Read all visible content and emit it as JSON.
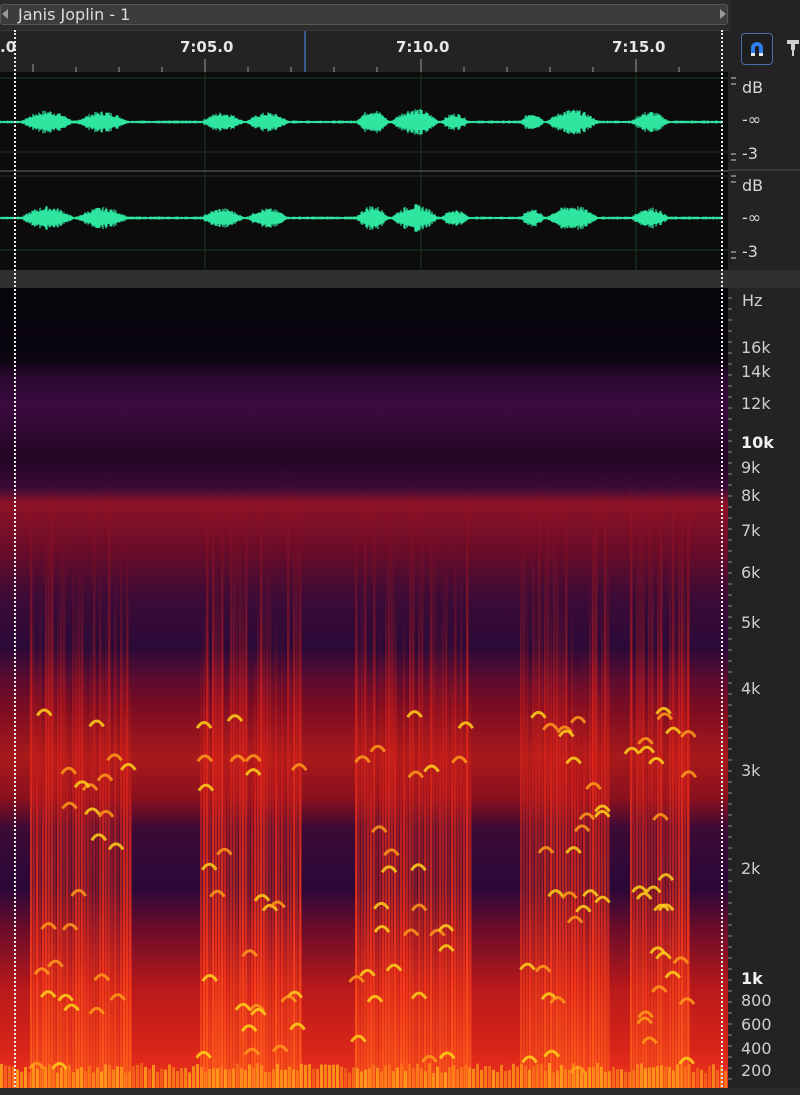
{
  "clip": {
    "title": "Janis Joplin - 1"
  },
  "ruler": {
    "labels": [
      ".0",
      "7:05.0",
      "7:10.0",
      "7:15.0"
    ]
  },
  "waveform": {
    "color": "#2ee6a0",
    "channels": [
      {
        "db_unit": "dB",
        "db_mid": "-∞",
        "db_low": "-3"
      },
      {
        "db_unit": "dB",
        "db_mid": "-∞",
        "db_low": "-3"
      }
    ]
  },
  "spectral": {
    "unit": "Hz",
    "labels": [
      "16k",
      "14k",
      "12k",
      "10k",
      "9k",
      "8k",
      "7k",
      "6k",
      "5k",
      "4k",
      "3k",
      "2k",
      "1k",
      "800",
      "600",
      "400",
      "200"
    ]
  },
  "buttons": {
    "snap": "magnet-icon",
    "pin": "pin-icon"
  },
  "colors": {
    "accent": "#4a6fa5",
    "background": "#232323",
    "spectral_hot": "#ffd21a",
    "spectral_mid": "#e8221a",
    "spectral_low": "#3b0a3e"
  }
}
